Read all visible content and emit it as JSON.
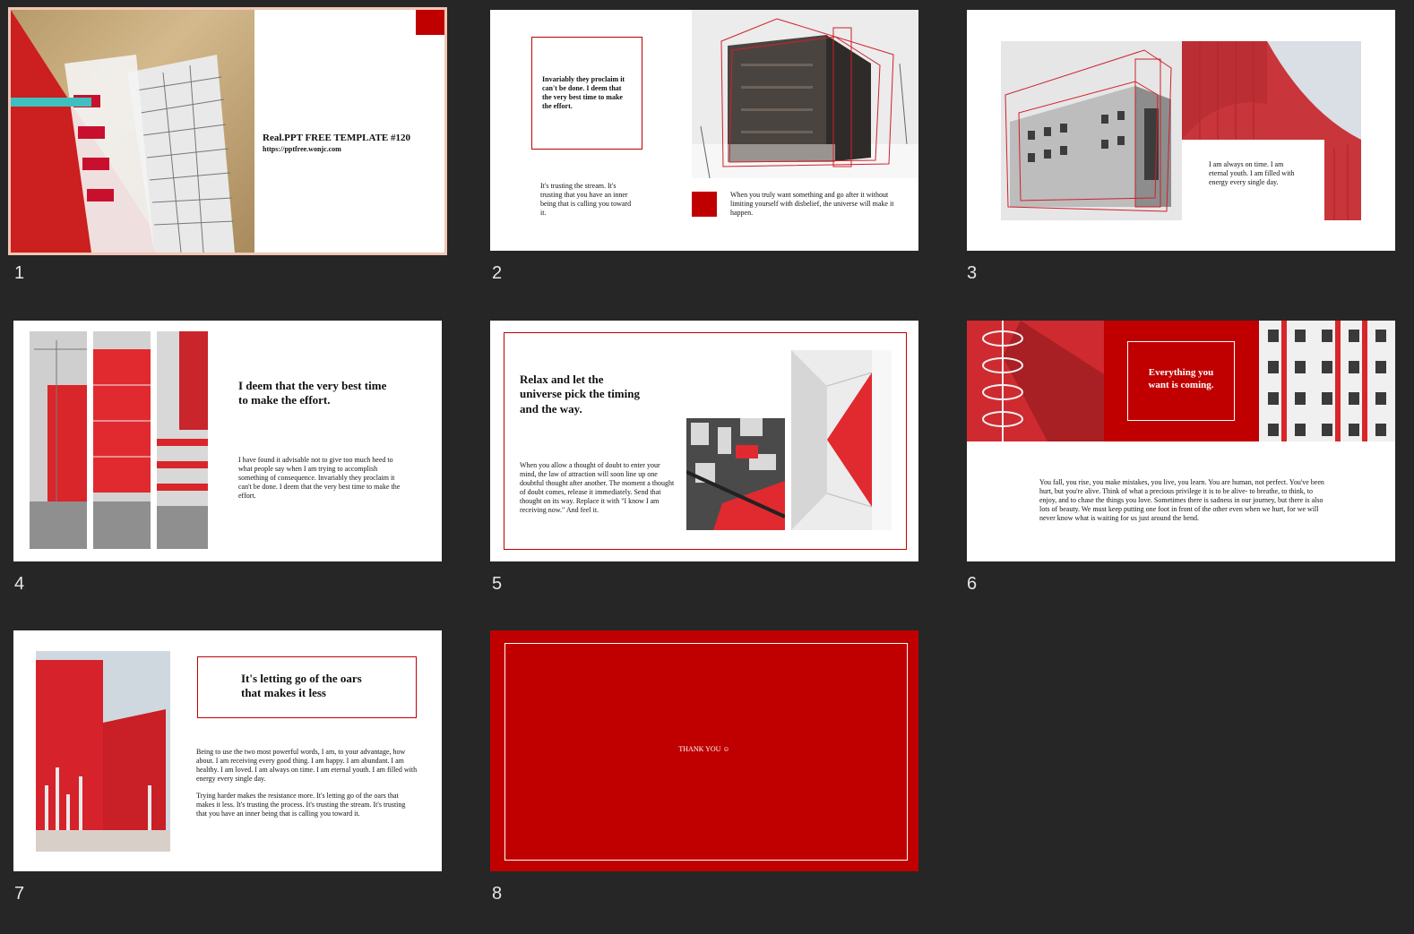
{
  "colors": {
    "background": "#262626",
    "accent_red": "#c00000",
    "selection_border": "#f2c6b4"
  },
  "slides": [
    {
      "number": "1",
      "title": "Real.PPT FREE TEMPLATE #120",
      "url": "https://pptfree.wonjc.com"
    },
    {
      "number": "2",
      "quote": "Invariably they proclaim it can't be done. I deem that the very best time to make the effort.",
      "body_left": "It's trusting the stream. It's trusting that you have an inner being that is calling you toward it.",
      "body_right": "When you truly want something and go after it without limiting yourself with disbelief, the universe will make it happen."
    },
    {
      "number": "3",
      "body": "I am always on time. I am eternal youth. I am filled with energy every single day."
    },
    {
      "number": "4",
      "heading": "I deem that the very best time to make the effort.",
      "body": "I have found it advisable not to give too much heed to what people say when I am trying to accomplish something of consequence. Invariably they proclaim it can't be done. I deem that the very best time to make the effort."
    },
    {
      "number": "5",
      "heading": "Relax and let the universe pick the timing and the way.",
      "body": "When you allow a thought of doubt to enter your mind, the law of attraction will soon line up one doubtful thought after another. The moment a thought of doubt comes, release it immediately. Send that thought on its way. Replace it with \"I know I am receiving now.\" And feel it."
    },
    {
      "number": "6",
      "box_text": "Everything you want is coming.",
      "body": "You fall, you rise, you make mistakes, you live, you learn. You are human, not perfect. You've been hurt, but you're alive. Think of what a precious privilege it is to be alive- to breathe, to think, to enjoy, and to chase the things you love. Sometimes there is sadness in our journey, but there is also lots of beauty. We must keep putting one foot in front of the other even when we hurt, for we will never know what is waiting for us just around the bend."
    },
    {
      "number": "7",
      "heading": "It's letting go of the oars that makes it less",
      "body1": "Being to use the two most powerful words, I am, to your advantage, how about. I am receiving every good thing. I am happy. I am abundant. I am healthy. I am loved. I am always on time. I am eternal youth. I am filled with energy every single day.",
      "body2": "Trying harder makes the resistance more. It's letting go of the oars that makes it less. It's trusting the process. It's trusting the stream. It's trusting that you have an inner being that is calling you toward it."
    },
    {
      "number": "8",
      "text": "THANK YOU ☺"
    }
  ]
}
